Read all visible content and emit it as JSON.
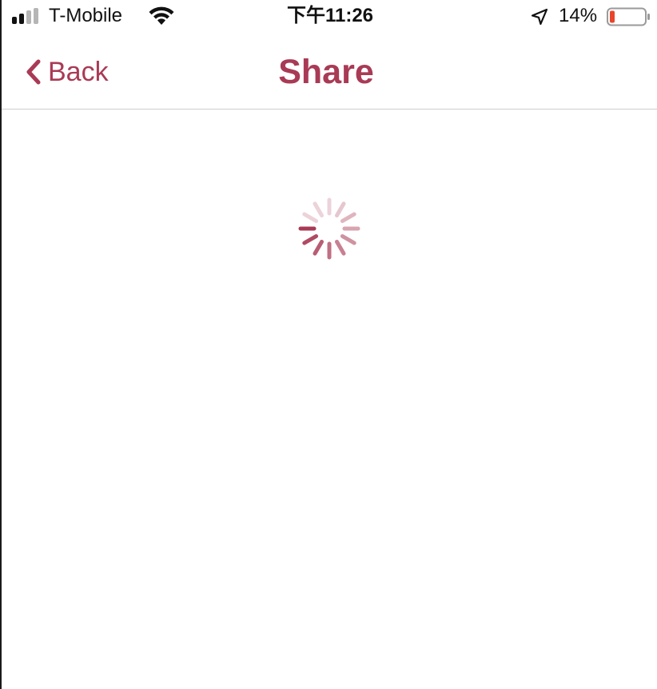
{
  "status_bar": {
    "carrier": "T-Mobile",
    "time": "下午11:26",
    "battery_percent": "14%",
    "battery_level": 0.14,
    "signal_bars_active": 2,
    "signal_bars_total": 4,
    "icons": [
      "signal-icon",
      "wifi-icon",
      "location-arrow-icon",
      "battery-icon"
    ],
    "battery_low_color": "#e8452c"
  },
  "nav": {
    "back_label": "Back",
    "title": "Share",
    "accent_color": "#a93a55"
  },
  "content": {
    "state": "loading",
    "spinner_icon": "activity-spinner-icon"
  }
}
